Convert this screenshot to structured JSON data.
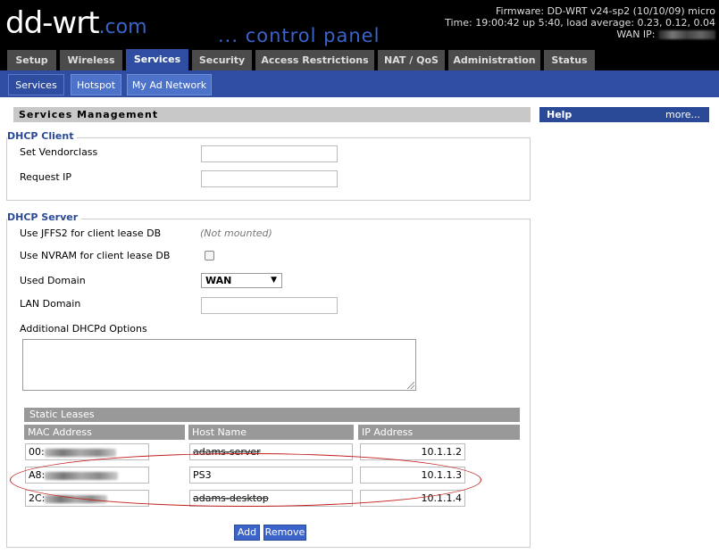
{
  "header": {
    "logo_main": "dd-wrt",
    "logo_com": ".com",
    "control_panel": "... control panel",
    "firmware": "Firmware: DD-WRT v24-sp2 (10/10/09) micro",
    "time": "Time: 19:00:42 up 5:40, load average: 0.23, 0.12, 0.04",
    "wan_ip_label": "WAN IP:"
  },
  "main_tabs": [
    "Setup",
    "Wireless",
    "Services",
    "Security",
    "Access Restrictions",
    "NAT / QoS",
    "Administration",
    "Status"
  ],
  "sub_tabs": [
    "Services",
    "Hotspot",
    "My Ad Network"
  ],
  "page": {
    "title": "Services Management",
    "help_title": "Help",
    "help_more": "more..."
  },
  "dhcp_client": {
    "legend": "DHCP Client",
    "vendorclass_label": "Set Vendorclass",
    "vendorclass_value": "",
    "request_ip_label": "Request IP",
    "request_ip_value": ""
  },
  "dhcp_server": {
    "legend": "DHCP Server",
    "jffs2_label": "Use JFFS2 for client lease DB",
    "jffs2_note": "(Not mounted)",
    "nvram_label": "Use NVRAM for client lease DB",
    "used_domain_label": "Used Domain",
    "used_domain_value": "WAN",
    "lan_domain_label": "LAN Domain",
    "lan_domain_value": "",
    "additional_options_label": "Additional DHCPd Options",
    "additional_options_value": ""
  },
  "static_leases": {
    "title": "Static Leases",
    "columns": [
      "MAC Address",
      "Host Name",
      "IP Address"
    ],
    "rows": [
      {
        "mac": "00:",
        "host": "adams-server",
        "ip": "10.1.1.2"
      },
      {
        "mac": "A8:",
        "host": "PS3",
        "ip": "10.1.1.3"
      },
      {
        "mac": "2C:",
        "host": "adams-desktop",
        "ip": "10.1.1.4"
      }
    ],
    "add_label": "Add",
    "remove_label": "Remove"
  },
  "colors": {
    "header_bg": "#000000",
    "brand_blue": "#2f4ea2",
    "highlight": "#c41e1e"
  }
}
